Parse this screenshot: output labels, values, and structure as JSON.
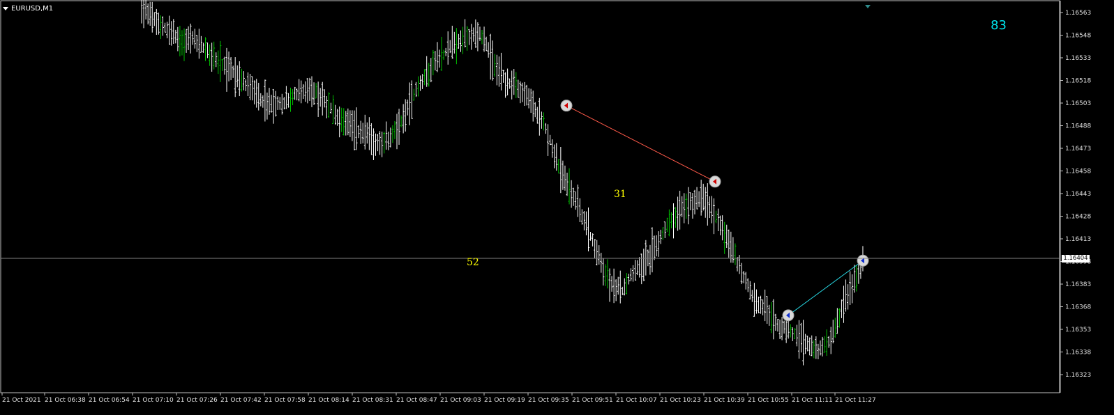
{
  "window": {
    "symbol_label": "EURUSD,M1",
    "corner_value": "83",
    "overlay_label_1": "31",
    "overlay_label_2": "52",
    "current_price": "1.16404"
  },
  "colors": {
    "background": "#000000",
    "bar": "#ffffff",
    "bull_highlight": "#00c000",
    "grid_line": "#808080",
    "line_red": "#ff5a4a",
    "line_cyan": "#27d5e0",
    "text_yellow": "#ffff00",
    "text_cyan": "#00e5ee"
  },
  "chart_data": {
    "type": "ohlc",
    "symbol": "EURUSD",
    "timeframe": "M1",
    "y_ticks": [
      "1.16563",
      "1.16548",
      "1.16533",
      "1.16518",
      "1.16503",
      "1.16488",
      "1.16473",
      "1.16458",
      "1.16443",
      "1.16428",
      "1.16413",
      "1.16398",
      "1.16383",
      "1.16368",
      "1.16353",
      "1.16338",
      "1.16323"
    ],
    "ylim": [
      1.16318,
      1.1657
    ],
    "x_ticks": [
      "21 Oct 2021",
      "21 Oct 06:38",
      "21 Oct 06:54",
      "21 Oct 07:10",
      "21 Oct 07:26",
      "21 Oct 07:42",
      "21 Oct 07:58",
      "21 Oct 08:14",
      "21 Oct 08:31",
      "21 Oct 08:47",
      "21 Oct 09:03",
      "21 Oct 09:19",
      "21 Oct 09:35",
      "21 Oct 09:51",
      "21 Oct 10:07",
      "21 Oct 10:23",
      "21 Oct 10:39",
      "21 Oct 10:55",
      "21 Oct 11:11",
      "21 Oct 11:27"
    ],
    "horizontal_line_price": 1.16404,
    "price_path": [
      [
        0.0,
        1.1657
      ],
      [
        3.1,
        1.16548
      ],
      [
        4.0,
        1.1655
      ],
      [
        5.0,
        1.16542
      ],
      [
        6.0,
        1.16534
      ],
      [
        7.0,
        1.16528
      ],
      [
        8.0,
        1.1652
      ],
      [
        9.0,
        1.16512
      ],
      [
        10.0,
        1.16506
      ],
      [
        11.0,
        1.16508
      ],
      [
        12.0,
        1.16514
      ],
      [
        13.0,
        1.16518
      ],
      [
        14.0,
        1.1651
      ],
      [
        15.0,
        1.165
      ],
      [
        16.0,
        1.16492
      ],
      [
        17.0,
        1.16488
      ],
      [
        18.0,
        1.16482
      ],
      [
        19.0,
        1.16484
      ],
      [
        20.0,
        1.16496
      ],
      [
        21.0,
        1.16514
      ],
      [
        22.0,
        1.16528
      ],
      [
        23.0,
        1.16538
      ],
      [
        24.0,
        1.16546
      ],
      [
        25.0,
        1.16552
      ],
      [
        26.0,
        1.16554
      ],
      [
        26.5,
        1.16546
      ],
      [
        27.0,
        1.16536
      ],
      [
        28.0,
        1.16522
      ],
      [
        29.0,
        1.16518
      ],
      [
        30.0,
        1.16508
      ],
      [
        31.0,
        1.16494
      ],
      [
        32.0,
        1.16468
      ],
      [
        33.0,
        1.1645
      ],
      [
        34.0,
        1.16432
      ],
      [
        35.0,
        1.1641
      ],
      [
        36.0,
        1.1639
      ],
      [
        37.0,
        1.16384
      ],
      [
        38.0,
        1.16398
      ],
      [
        39.0,
        1.16406
      ],
      [
        40.0,
        1.1642
      ],
      [
        41.0,
        1.16434
      ],
      [
        42.0,
        1.1644
      ],
      [
        43.0,
        1.16446
      ],
      [
        44.0,
        1.16436
      ],
      [
        45.0,
        1.1642
      ],
      [
        46.0,
        1.164
      ],
      [
        47.0,
        1.1638
      ],
      [
        48.0,
        1.16372
      ],
      [
        49.0,
        1.1636
      ],
      [
        50.0,
        1.16358
      ],
      [
        51.0,
        1.1635
      ],
      [
        52.0,
        1.16344
      ],
      [
        53.0,
        1.16352
      ],
      [
        54.0,
        1.16374
      ],
      [
        55.0,
        1.16392
      ],
      [
        55.5,
        1.16404
      ]
    ],
    "markers": [
      {
        "price": 1.16506,
        "dir": "sell"
      },
      {
        "price": 1.16456,
        "dir": "sell"
      },
      {
        "price": 1.16368,
        "dir": "buy"
      },
      {
        "price": 1.16404,
        "dir": "buy"
      }
    ],
    "trend_lines": [
      {
        "from": 0,
        "to": 1,
        "color": "red"
      },
      {
        "from": 2,
        "to": 3,
        "color": "cyan"
      }
    ]
  }
}
